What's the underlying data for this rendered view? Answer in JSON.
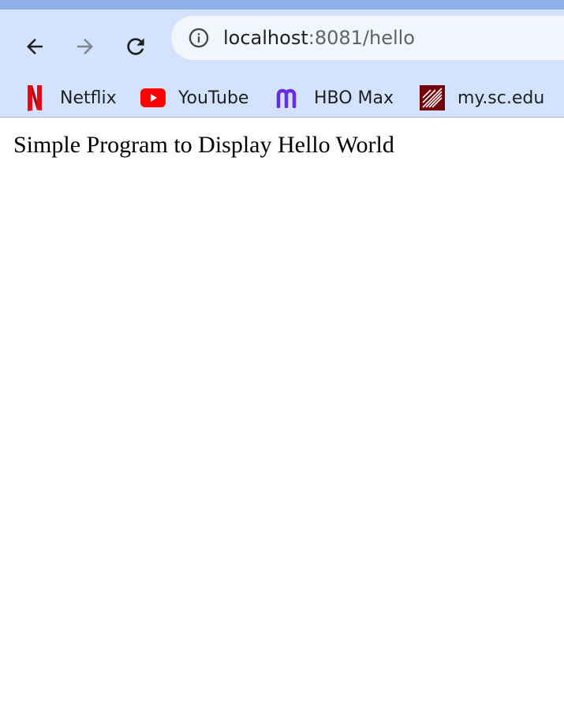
{
  "browser": {
    "address": {
      "host": "localhost",
      "rest": ":8081/hello"
    },
    "bookmarks": [
      {
        "label": "Netflix",
        "icon": "netflix-icon",
        "color": "#e50914"
      },
      {
        "label": "YouTube",
        "icon": "youtube-icon",
        "color": "#ff0000"
      },
      {
        "label": "HBO Max",
        "icon": "hbo-max-icon",
        "color": "#6a2be6"
      },
      {
        "label": "my.sc.edu",
        "icon": "sc-edu-icon",
        "color": "#73000a"
      }
    ],
    "colors": {
      "toolbar": "#d3e3fd",
      "top_strip": "#8db0e8",
      "omnibox": "#f2f6fc"
    }
  },
  "page": {
    "text": "Simple Program to Display Hello World"
  }
}
